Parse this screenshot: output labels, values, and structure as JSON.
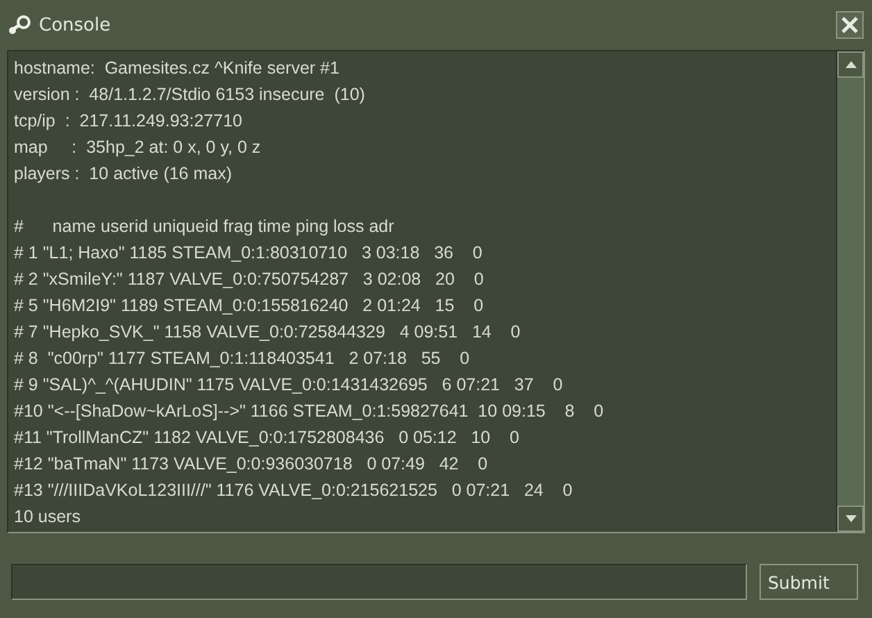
{
  "window": {
    "title": "Console"
  },
  "console": {
    "sections": [
      {
        "lines": [
          "hostname:  Gamesites.cz ^Knife server #1",
          "version :  48/1.1.2.7/Stdio 6153 insecure  (10)",
          "tcp/ip  :  217.11.249.93:27710",
          "map     :  35hp_2 at: 0 x, 0 y, 0 z",
          "players :  10 active (16 max)"
        ]
      },
      {
        "lines": [
          "#      name userid uniqueid frag time ping loss adr",
          "# 1 \"L1; Haxo\" 1185 STEAM_0:1:80310710   3 03:18   36    0",
          "# 2 \"xSmileY:\" 1187 VALVE_0:0:750754287   3 02:08   20    0",
          "# 5 \"H6M2I9\" 1189 STEAM_0:0:155816240   2 01:24   15    0",
          "# 7 \"Hepko_SVK_\" 1158 VALVE_0:0:725844329   4 09:51   14    0",
          "# 8  \"c00rp\" 1177 STEAM_0:1:118403541   2 07:18   55    0",
          "# 9 \"SAL)^_^(AHUDIN\" 1175 VALVE_0:0:1431432695   6 07:21   37    0",
          "#10 \"<--[ShaDow~kArLoS]-->\" 1166 STEAM_0:1:59827641  10 09:15    8    0",
          "#11 \"TrollManCZ\" 1182 VALVE_0:0:1752808436   0 05:12   10    0",
          "#12 \"baTmaN\" 1173 VALVE_0:0:936030718   0 07:49   42    0",
          "#13 \"///IIIDaVKoL123III///\" 1176 VALVE_0:0:215621525   0 07:21   24    0",
          "10 users"
        ]
      }
    ]
  },
  "submit": {
    "label": "Submit"
  }
}
